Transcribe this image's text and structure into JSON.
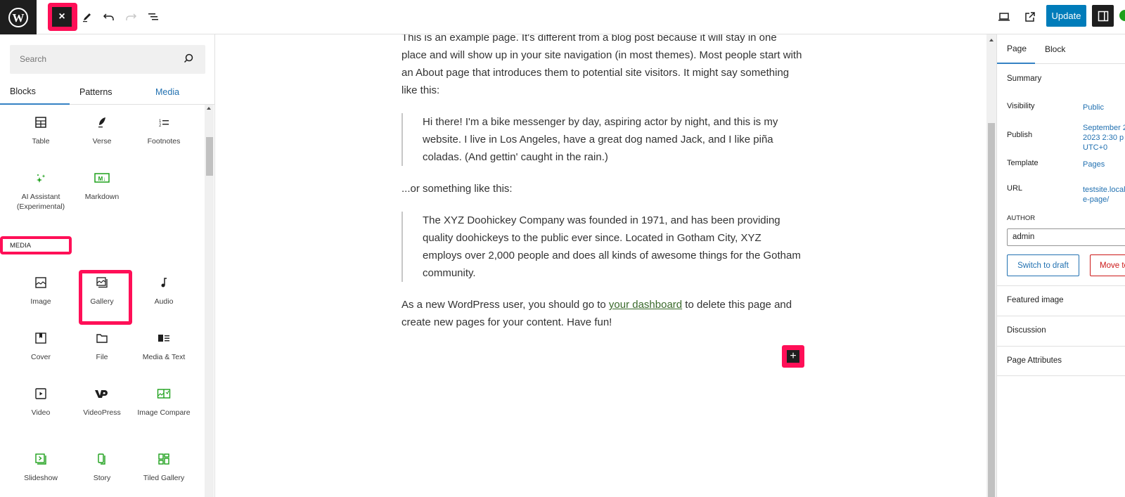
{
  "topbar": {
    "close_label": "×",
    "icons": [
      "wordpress-logo",
      "close-icon",
      "pencil-icon",
      "undo-icon",
      "redo-icon",
      "list-view-icon",
      "desktop-preview-icon",
      "external-link-icon",
      "settings-sidebar-icon"
    ],
    "update_label": "Update"
  },
  "inserter": {
    "search_placeholder": "Search",
    "tabs": [
      {
        "label": "Blocks",
        "active": true
      },
      {
        "label": "Patterns",
        "active": false
      },
      {
        "label": "Media",
        "active": false
      }
    ],
    "blocks_top": [
      {
        "label": "Table",
        "icon": "table-icon"
      },
      {
        "label": "Verse",
        "icon": "verse-icon"
      },
      {
        "label": "Footnotes",
        "icon": "footnotes-icon"
      },
      {
        "label": "AI Assistant (Experimental)",
        "icon": "ai-sparkle-icon"
      },
      {
        "label": "Markdown",
        "icon": "markdown-icon"
      }
    ],
    "media_heading": "MEDIA",
    "media_blocks": [
      {
        "label": "Image",
        "icon": "image-icon"
      },
      {
        "label": "Gallery",
        "icon": "gallery-icon"
      },
      {
        "label": "Audio",
        "icon": "audio-icon"
      },
      {
        "label": "Cover",
        "icon": "cover-icon"
      },
      {
        "label": "File",
        "icon": "file-icon"
      },
      {
        "label": "Media & Text",
        "icon": "media-text-icon"
      },
      {
        "label": "Video",
        "icon": "video-icon"
      },
      {
        "label": "VideoPress",
        "icon": "videopress-icon"
      },
      {
        "label": "Image Compare",
        "icon": "image-compare-icon"
      },
      {
        "label": "Slideshow",
        "icon": "slideshow-icon"
      },
      {
        "label": "Story",
        "icon": "story-icon"
      },
      {
        "label": "Tiled Gallery",
        "icon": "tiled-gallery-icon"
      }
    ]
  },
  "editor": {
    "para1": "This is an example page. It's different from a blog post because it will stay in one place and will show up in your site navigation (in most themes). Most people start with an About page that introduces them to potential site visitors. It might say something like this:",
    "quote1": "Hi there! I'm a bike messenger by day, aspiring actor by night, and this is my website. I live in Los Angeles, have a great dog named Jack, and I like piña coladas. (And gettin' caught in the rain.)",
    "para2": "...or something like this:",
    "quote2": "The XYZ Doohickey Company was founded in 1971, and has been providing quality doohickeys to the public ever since. Located in Gotham City, XYZ employs over 2,000 people and does all kinds of awesome things for the Gotham community.",
    "para3_before": "As a new WordPress user, you should go to ",
    "para3_link": "your dashboard",
    "para3_after": " to delete this page and create new pages for your content. Have fun!",
    "add_block_label": "+"
  },
  "sidebar": {
    "tabs": [
      {
        "label": "Page",
        "active": true
      },
      {
        "label": "Block",
        "active": false
      }
    ],
    "summary_title": "Summary",
    "rows": [
      {
        "label": "Visibility",
        "value": "Public"
      },
      {
        "label": "Publish",
        "value": "September 2\n2023 2:30 p\nUTC+0"
      },
      {
        "label": "Template",
        "value": "Pages"
      },
      {
        "label": "URL",
        "value": "testsite.local\ne-page/"
      }
    ],
    "author_label": "AUTHOR",
    "author_value": "admin",
    "switch_draft_label": "Switch to draft",
    "trash_label": "Move to trash",
    "panels": [
      "Featured image",
      "Discussion",
      "Page Attributes"
    ]
  },
  "colors": {
    "accent": "#007cba",
    "highlight": "#ff0f57",
    "link": "#2271b1",
    "danger": "#cc1818",
    "jetpack_green": "#1da01a"
  }
}
